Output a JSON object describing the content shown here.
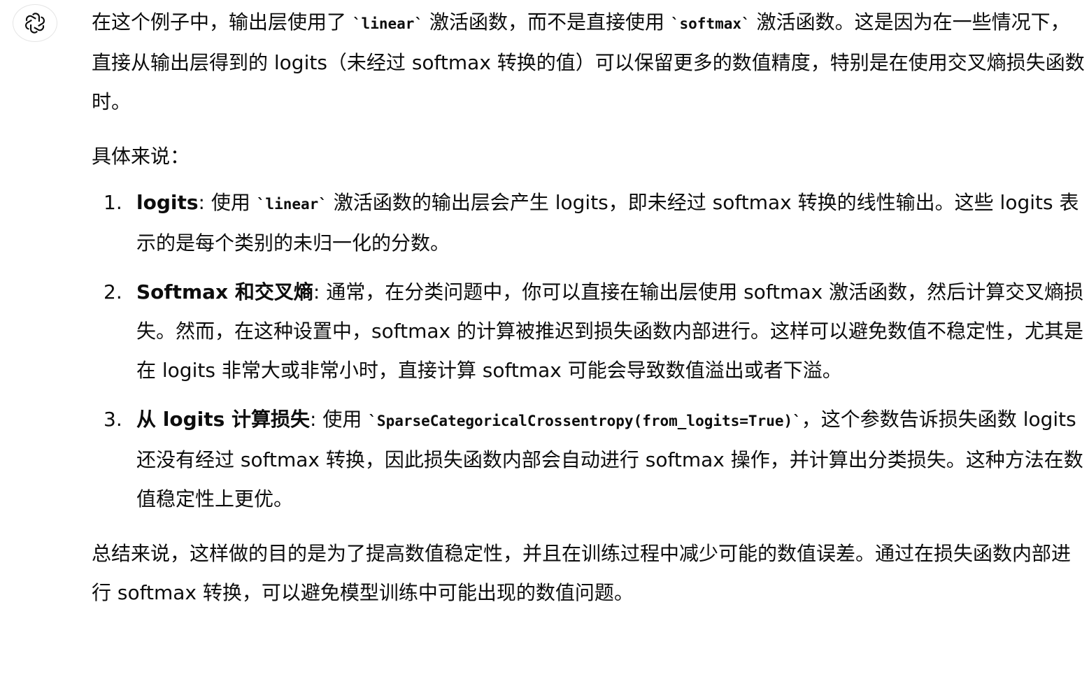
{
  "assistant": {
    "avatar_icon": "openai-logo-icon"
  },
  "para1": {
    "t1": "在这个例子中，输出层使用了 ",
    "code1": "`linear`",
    "t2": " 激活函数，而不是直接使用 ",
    "code2": "`softmax`",
    "t3": " 激活函数。这是因为在一些情况下，直接从输出层得到的 logits（未经过 softmax 转换的值）可以保留更多的数值精度，特别是在使用交叉熵损失函数时。"
  },
  "para2": "具体来说：",
  "list": [
    {
      "number": "1.",
      "title": "logits",
      "t1": ": 使用 ",
      "code": "`linear`",
      "t2": " 激活函数的输出层会产生 logits，即未经过 softmax 转换的线性输出。这些 logits 表示的是每个类别的未归一化的分数。"
    },
    {
      "number": "2.",
      "title": "Softmax 和交叉熵",
      "t1": ": 通常，在分类问题中，你可以直接在输出层使用 softmax 激活函数，然后计算交叉熵损失。然而，在这种设置中，softmax 的计算被推迟到损失函数内部进行。这样可以避免数值不稳定性，尤其是在 logits 非常大或非常小时，直接计算 softmax 可能会导致数值溢出或者下溢。"
    },
    {
      "number": "3.",
      "title": "从 logits 计算损失",
      "t1": ": 使用 ",
      "code": "`SparseCategoricalCrossentropy(from_logits=True)`",
      "t2": "，这个参数告诉损失函数 logits 还没有经过 softmax 转换，因此损失函数内部会自动进行 softmax 操作，并计算出分类损失。这种方法在数值稳定性上更优。"
    }
  ],
  "para3": "总结来说，这样做的目的是为了提高数值稳定性，并且在训练过程中减少可能的数值误差。通过在损失函数内部进行 softmax 转换，可以避免模型训练中可能出现的数值问题。"
}
